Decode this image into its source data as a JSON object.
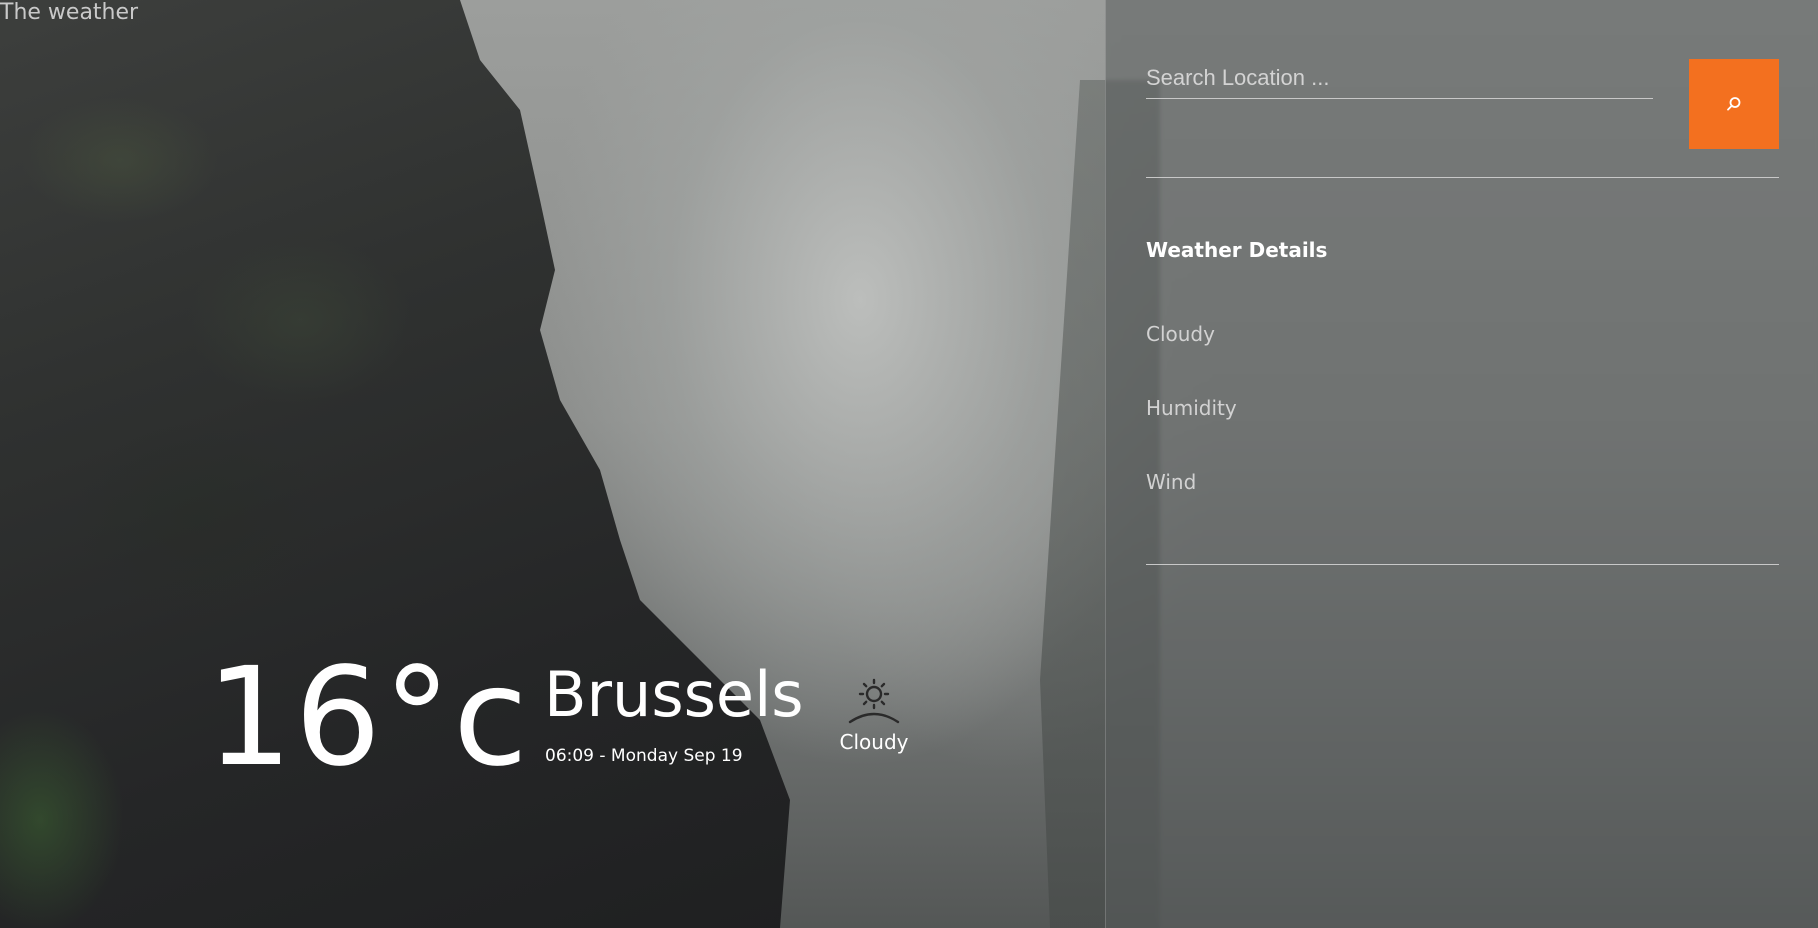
{
  "app": {
    "title": "The weather"
  },
  "current": {
    "temperature": "16",
    "unit": "°c",
    "city": "Brussels",
    "datetime": "06:09 - Monday Sep 19",
    "condition_label": "Cloudy",
    "condition_icon": "sunrise-icon"
  },
  "panel": {
    "search": {
      "placeholder": "Search Location ...",
      "value": "",
      "button_icon": "search-icon",
      "button_color": "#f3701f"
    },
    "details_title": "Weather Details",
    "details": [
      {
        "label": "Cloudy"
      },
      {
        "label": "Humidity"
      },
      {
        "label": "Wind"
      }
    ]
  }
}
